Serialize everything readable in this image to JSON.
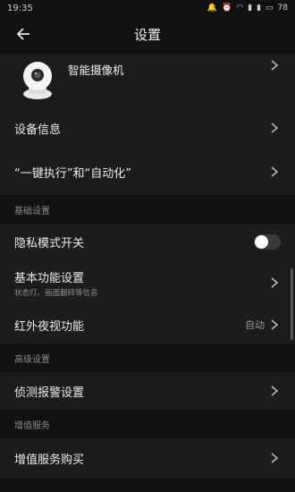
{
  "status_bar": {
    "time": "19:35",
    "battery": "78"
  },
  "header": {
    "title": "设置"
  },
  "device": {
    "name": "智能摄像机"
  },
  "rows_top": [
    {
      "label": "设备信息"
    },
    {
      "label": "“一键执行”和“自动化”"
    }
  ],
  "section_basic": {
    "title": "基础设置"
  },
  "privacy": {
    "label": "隐私模式开关",
    "enabled": false
  },
  "basic_function": {
    "label": "基本功能设置",
    "sub": "状态灯、画面翻转等信息"
  },
  "infrared": {
    "label": "红外夜视功能",
    "value": "自动"
  },
  "section_advanced": {
    "title": "高级设置"
  },
  "detection": {
    "label": "侦测报警设置"
  },
  "section_value_added": {
    "title": "增值服务"
  },
  "purchase": {
    "label": "增值服务购买"
  },
  "colors": {
    "background": "#111111",
    "row_bg": "#1c1c1c",
    "section_text": "#8b8b8b"
  }
}
